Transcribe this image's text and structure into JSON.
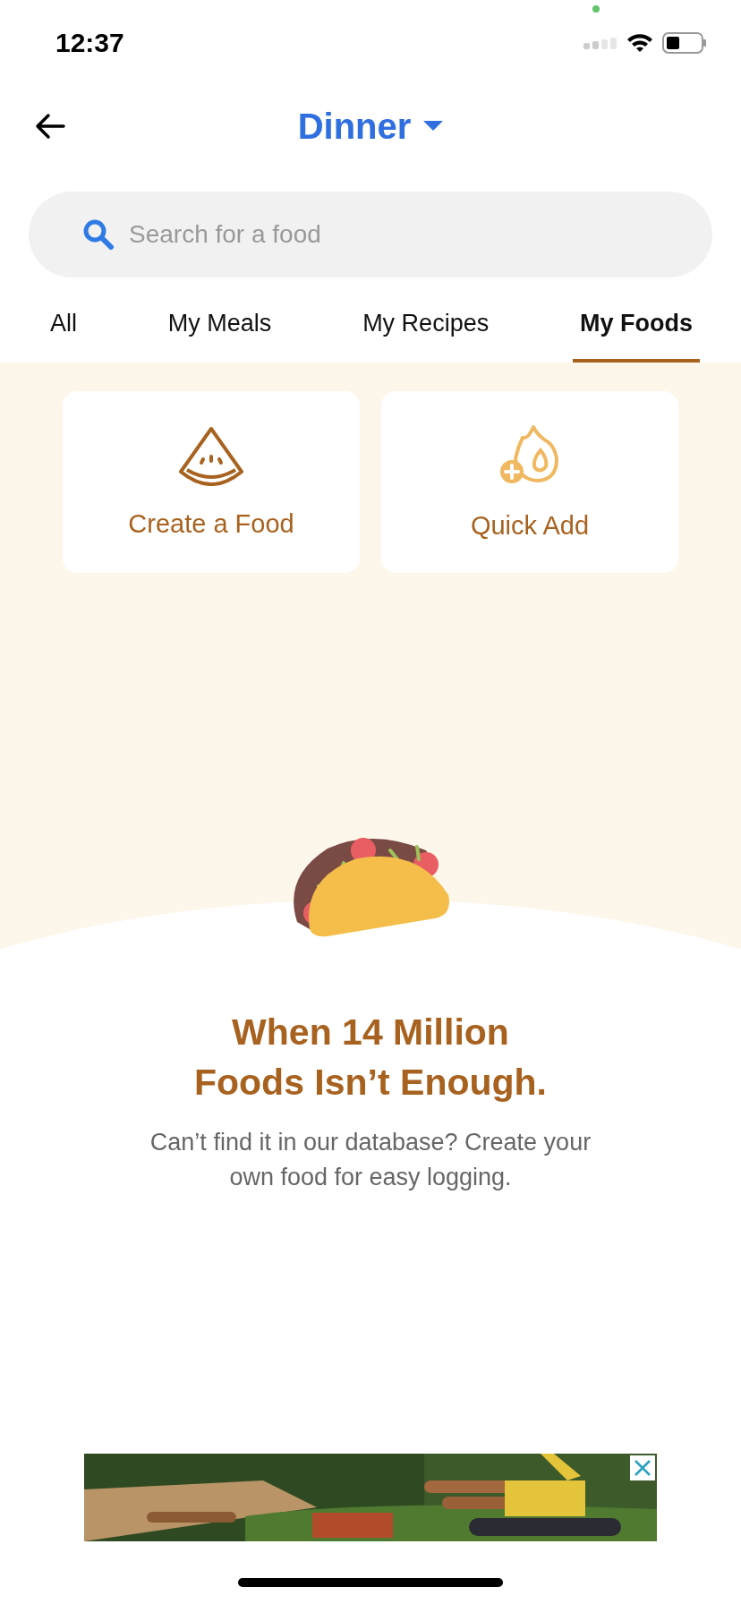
{
  "status_bar": {
    "time": "12:37"
  },
  "header": {
    "title": "Dinner"
  },
  "search": {
    "placeholder": "Search for a food"
  },
  "tabs": [
    {
      "label": "All",
      "selected": false
    },
    {
      "label": "My Meals",
      "selected": false
    },
    {
      "label": "My Recipes",
      "selected": false
    },
    {
      "label": "My Foods",
      "selected": true
    }
  ],
  "actions": [
    {
      "kind": "create",
      "label": "Create a Food"
    },
    {
      "kind": "quick",
      "label": "Quick Add"
    }
  ],
  "empty_state": {
    "heading_lines": [
      "When 14 Million",
      "Foods Isn’t Enough."
    ],
    "message": "Can’t find it in our database? Create your own food for easy logging."
  }
}
